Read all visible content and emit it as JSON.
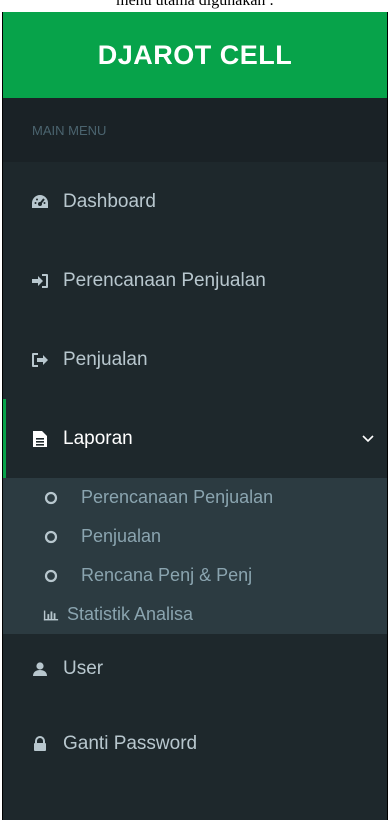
{
  "top_caption": "menu utama digunakan :",
  "brand": {
    "title": "DJAROT CELL",
    "color": "#07a34a"
  },
  "sidebar": {
    "header": "MAIN MENU",
    "items": [
      {
        "label": "Dashboard",
        "icon": "dashboard-icon"
      },
      {
        "label": "Perencanaan Penjualan",
        "icon": "sign-in-icon"
      },
      {
        "label": "Penjualan",
        "icon": "sign-out-icon"
      },
      {
        "label": "Laporan",
        "icon": "file-icon",
        "active": true,
        "expanded": true
      }
    ],
    "submenu": [
      {
        "label": "Perencanaan Penjualan",
        "icon": "circle-icon"
      },
      {
        "label": "Penjualan",
        "icon": "circle-icon"
      },
      {
        "label": "Rencana Penj & Penj",
        "icon": "circle-icon"
      },
      {
        "label": "Statistik Analisa",
        "icon": "bar-chart-icon"
      }
    ],
    "bottom_items": [
      {
        "label": "User",
        "icon": "user-icon"
      },
      {
        "label": "Ganti Password",
        "icon": "lock-icon"
      }
    ]
  }
}
